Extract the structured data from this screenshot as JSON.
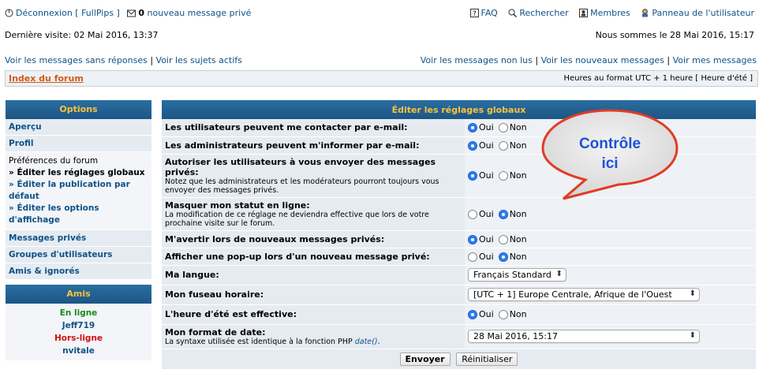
{
  "top": {
    "logout": "Déconnexion [ FullPips ]",
    "pm_count": "0",
    "pm_text": "nouveau message privé",
    "faq": "FAQ",
    "search": "Rechercher",
    "members": "Membres",
    "ucp": "Panneau de l'utilisateur"
  },
  "visit": {
    "last": "Dernière visite: 02 Mai 2016, 13:37",
    "now": "Nous sommes le 28 Mai 2016, 15:17"
  },
  "searchlinks": {
    "unanswered": "Voir les messages sans réponses",
    "active": "Voir les sujets actifs",
    "unread": "Voir les messages non lus",
    "new": "Voir les nouveaux messages",
    "mine": "Voir mes messages"
  },
  "navbar": {
    "index": "Index du forum",
    "timezone": "Heures au format UTC + 1 heure [ Heure d'été ]"
  },
  "sidebar": {
    "title": "Options",
    "overview": "Aperçu",
    "profile": "Profil",
    "prefs_title": "Préférences du forum",
    "prefs_global": "» Éditer les réglages globaux",
    "prefs_post": "» Éditer la publication par défaut",
    "prefs_view": "» Éditer les options d'affichage",
    "pm": "Messages privés",
    "groups": "Groupes d'utilisateurs",
    "friends_foes": "Amis & ignorés"
  },
  "friends": {
    "title": "Amis",
    "online_label": "En ligne",
    "online_user": "Jeff719",
    "offline_label": "Hors-ligne",
    "offline_user": "nvitale"
  },
  "settings": {
    "title": "Éditer les réglages globaux",
    "yes": "Oui",
    "no": "Non",
    "rows": [
      {
        "label": "Les utilisateurs peuvent me contacter par e-mail:",
        "explain": "",
        "choice": "yes"
      },
      {
        "label": "Les administrateurs peuvent m'informer par e-mail:",
        "explain": "",
        "choice": "yes"
      },
      {
        "label": "Autoriser les utilisateurs à vous envoyer des messages privés:",
        "explain": "Notez que les administrateurs et les modérateurs pourront toujours vous envoyer des messages privés.",
        "choice": "yes"
      },
      {
        "label": "Masquer mon statut en ligne:",
        "explain": "La modification de ce réglage ne deviendra effective que lors de votre prochaine visite sur le forum.",
        "choice": "no"
      },
      {
        "label": "M'avertir lors de nouveaux messages privés:",
        "explain": "",
        "choice": "yes"
      },
      {
        "label": "Afficher une pop-up lors d'un nouveau message privé:",
        "explain": "",
        "choice": "no"
      }
    ],
    "language_label": "Ma langue:",
    "language_value": "Français Standard",
    "timezone_label": "Mon fuseau horaire:",
    "timezone_value": "[UTC + 1] Europe Centrale, Afrique de l'Ouest",
    "dst_label": "L'heure d'été est effective:",
    "dst_choice": "yes",
    "dateformat_label": "Mon format de date:",
    "dateformat_explain": "La syntaxe utilisée est identique à la fonction PHP",
    "dateformat_func": "date()",
    "dateformat_explain_end": ".",
    "dateformat_value": "28 Mai 2016, 15:17",
    "submit": "Envoyer",
    "reset": "Réinitialiser"
  },
  "callout": {
    "line1": "Contrôle",
    "line2": "ici"
  }
}
